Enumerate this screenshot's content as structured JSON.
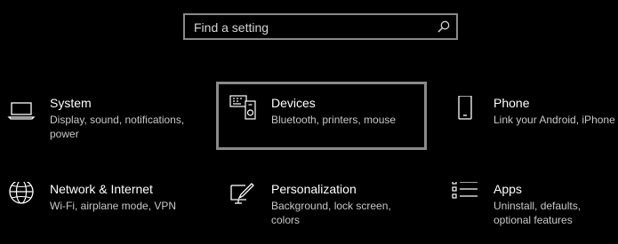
{
  "search": {
    "placeholder": "Find a setting",
    "icon": "search-icon"
  },
  "categories": [
    {
      "title": "System",
      "description": "Display, sound, notifications, power",
      "icon": "laptop-icon"
    },
    {
      "title": "Devices",
      "description": "Bluetooth, printers, mouse",
      "icon": "devices-icon",
      "focused": true
    },
    {
      "title": "Phone",
      "description": "Link your Android, iPhone",
      "icon": "phone-icon"
    },
    {
      "title": "Network & Internet",
      "description": "Wi-Fi, airplane mode, VPN",
      "icon": "globe-icon"
    },
    {
      "title": "Personalization",
      "description": "Background, lock screen, colors",
      "icon": "paintbrush-icon"
    },
    {
      "title": "Apps",
      "description": "Uninstall, defaults, optional features",
      "icon": "apps-list-icon"
    }
  ],
  "colors": {
    "background": "#000000",
    "border": "#8a8a8a",
    "text": "#ffffff",
    "subtext": "#c8c8c8"
  }
}
